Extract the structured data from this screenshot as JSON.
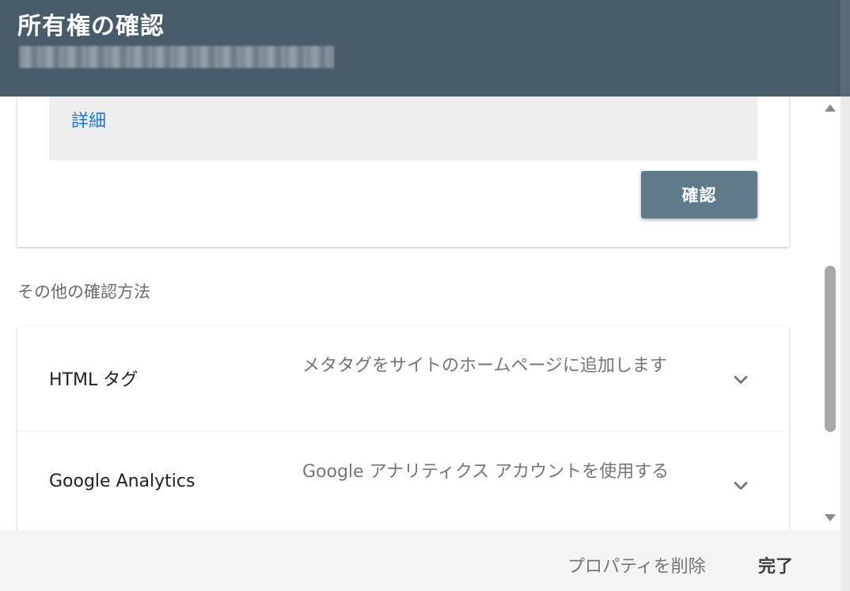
{
  "header": {
    "title": "所有権の確認"
  },
  "verify_card": {
    "details_link": "詳細",
    "verify_button": "確認"
  },
  "other_methods": {
    "label": "その他の確認方法",
    "items": [
      {
        "name": "HTML タグ",
        "description": "メタタグをサイトのホームページに追加します"
      },
      {
        "name": "Google Analytics",
        "description": "Google アナリティクス アカウントを使用する"
      }
    ]
  },
  "footer": {
    "delete_button": "プロパティを削除",
    "done_button": "完了"
  },
  "colors": {
    "header_bg": "#485b68",
    "primary_button": "#5f7b8a",
    "link": "#1a73e8"
  },
  "icons": [
    "chevron-down-icon",
    "scroll-up-arrow",
    "scroll-down-arrow"
  ]
}
